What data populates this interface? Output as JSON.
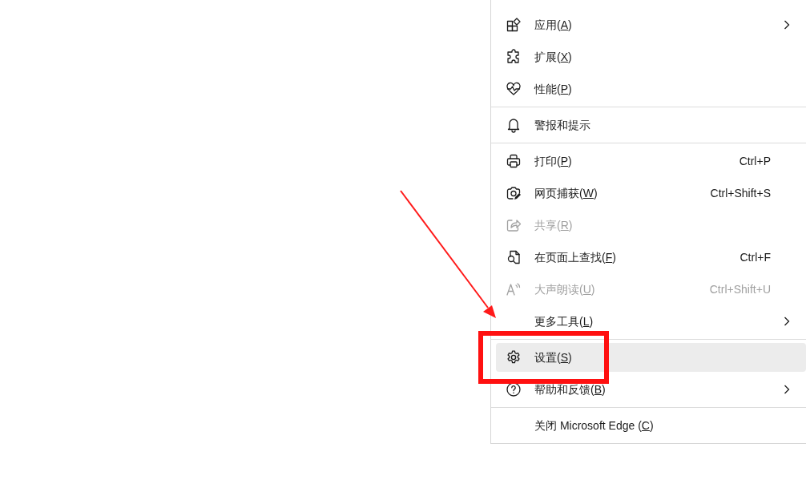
{
  "menu": {
    "items": [
      {
        "kind": "item",
        "label": {
          "before": "应用(",
          "key": "A",
          "after": ")"
        },
        "submenu": true,
        "disabled": false,
        "hovered": false
      },
      {
        "kind": "item",
        "label": {
          "before": "扩展(",
          "key": "X",
          "after": ")"
        },
        "submenu": false,
        "disabled": false,
        "hovered": false
      },
      {
        "kind": "item",
        "label": {
          "before": "性能(",
          "key": "P",
          "after": ")"
        },
        "submenu": false,
        "disabled": false,
        "hovered": false
      },
      {
        "kind": "divider"
      },
      {
        "kind": "item",
        "label": {
          "before": "警报和提示"
        },
        "submenu": false,
        "disabled": false,
        "hovered": false
      },
      {
        "kind": "divider"
      },
      {
        "kind": "item",
        "label": {
          "before": "打印(",
          "key": "P",
          "after": ")"
        },
        "shortcut": "Ctrl+P",
        "submenu": false,
        "disabled": false,
        "hovered": false
      },
      {
        "kind": "item",
        "label": {
          "before": "网页捕获(",
          "key": "W",
          "after": ")"
        },
        "shortcut": "Ctrl+Shift+S",
        "submenu": false,
        "disabled": false,
        "hovered": false
      },
      {
        "kind": "item",
        "label": {
          "before": "共享(",
          "key": "R",
          "after": ")"
        },
        "submenu": false,
        "disabled": true,
        "hovered": false
      },
      {
        "kind": "item",
        "label": {
          "before": "在页面上查找(",
          "key": "F",
          "after": ")"
        },
        "shortcut": "Ctrl+F",
        "submenu": false,
        "disabled": false,
        "hovered": false
      },
      {
        "kind": "item",
        "label": {
          "before": "大声朗读(",
          "key": "U",
          "after": ")"
        },
        "shortcut": "Ctrl+Shift+U",
        "submenu": false,
        "disabled": true,
        "hovered": false
      },
      {
        "kind": "item",
        "label": {
          "before": "更多工具(",
          "key": "L",
          "after": ")"
        },
        "submenu": true,
        "disabled": false,
        "hovered": false
      },
      {
        "kind": "divider"
      },
      {
        "kind": "item",
        "label": {
          "before": "设置(",
          "key": "S",
          "after": ")"
        },
        "submenu": false,
        "disabled": false,
        "hovered": true
      },
      {
        "kind": "item",
        "label": {
          "before": "帮助和反馈(",
          "key": "B",
          "after": ")"
        },
        "submenu": true,
        "disabled": false,
        "hovered": false
      },
      {
        "kind": "divider"
      },
      {
        "kind": "item",
        "label": {
          "before": "关闭 Microsoft Edge (",
          "key": "C",
          "after": ")"
        },
        "submenu": false,
        "disabled": false,
        "hovered": false
      }
    ]
  }
}
